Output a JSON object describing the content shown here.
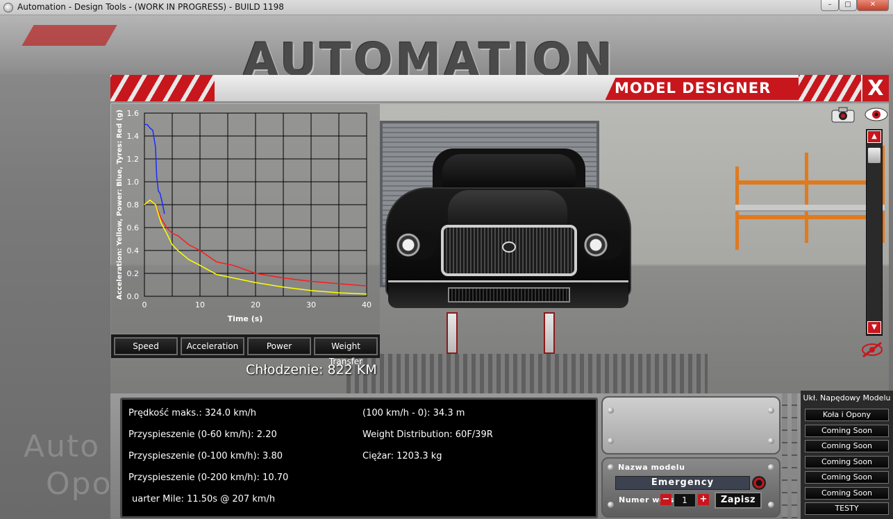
{
  "window": {
    "title": "Automation - Design Tools - (WORK IN PROGRESS) - BUILD 1198",
    "minimize": "–",
    "maximize": "□",
    "close": "✕"
  },
  "background": {
    "logo": "AUTOMATION",
    "left_text_1": "Auto",
    "left_text_2": "Opo"
  },
  "designer": {
    "title": "MODEL DESIGNER",
    "close": "X",
    "cooling": "Chłodzenie: 822 KM"
  },
  "chart_tabs": [
    "Speed",
    "Acceleration",
    "Power",
    "Weight Transfer"
  ],
  "chart_data": {
    "type": "line",
    "xlabel": "Time (s)",
    "ylabel": "Acceleration: Yellow, Power: Blue, Tyres: Red (g)",
    "xlim": [
      0,
      40
    ],
    "ylim": [
      0,
      1.6
    ],
    "xticks": [
      "0",
      "10",
      "20",
      "30",
      "40"
    ],
    "yticks": [
      "0.0",
      "0.2",
      "0.4",
      "0.6",
      "0.8",
      "1.0",
      "1.2",
      "1.4",
      "1.6"
    ],
    "grid": true,
    "series": [
      {
        "color": "#1a2bff",
        "x": [
          0,
          0.5,
          1.0,
          1.5,
          2.0,
          2.2,
          2.5,
          2.8,
          3.2,
          3.6
        ],
        "y": [
          1.5,
          1.5,
          1.47,
          1.45,
          1.3,
          1.05,
          0.92,
          0.9,
          0.82,
          0.72
        ]
      },
      {
        "color": "#ff1a1a",
        "x": [
          0,
          1,
          2,
          3,
          4,
          5,
          6,
          8,
          10,
          13,
          16,
          20,
          25,
          30,
          35,
          40
        ],
        "y": [
          0.8,
          0.84,
          0.8,
          0.68,
          0.6,
          0.55,
          0.53,
          0.45,
          0.4,
          0.3,
          0.27,
          0.2,
          0.16,
          0.13,
          0.11,
          0.09
        ]
      },
      {
        "color": "#ffff00",
        "x": [
          0,
          1,
          2,
          3,
          4,
          5,
          6,
          8,
          10,
          13,
          16,
          20,
          25,
          30,
          35,
          40
        ],
        "y": [
          0.8,
          0.84,
          0.8,
          0.64,
          0.55,
          0.45,
          0.4,
          0.32,
          0.27,
          0.19,
          0.16,
          0.12,
          0.08,
          0.05,
          0.03,
          0.02
        ]
      }
    ]
  },
  "stats": {
    "top_speed": "Prędkość maks.: 324.0 km/h",
    "accel_0_60": "Przyspieszenie (0-60 km/h): 2.20",
    "accel_0_100": "Przyspieszenie (0-100 km/h): 3.80",
    "accel_0_200": "Przyspieszenie (0-200 km/h): 10.70",
    "quarter_mile": "uarter Mile: 11.50s @ 207 km/h",
    "braking": "(100 km/h - 0): 34.3 m",
    "weight_distribution": "Weight Distribution: 60F/39R",
    "weight": "Ciężar: 1203.3 kg"
  },
  "model": {
    "name_label": "Nazwa modelu",
    "name_value": "Emergency",
    "version_label": "Numer wersji",
    "version_value": "1",
    "minus": "−",
    "plus": "+",
    "save": "Zapisz"
  },
  "menu": {
    "title": "Ukł. Napędowy Modelu",
    "items": [
      "Koła i Opony",
      "Coming Soon",
      "Coming Soon",
      "Coming Soon",
      "Coming Soon",
      "Coming Soon",
      "TESTY"
    ]
  },
  "icons": {
    "camera": "camera-icon",
    "eye": "eye-icon",
    "hide": "hide-overlay-icon",
    "gear": "gear-icon"
  }
}
